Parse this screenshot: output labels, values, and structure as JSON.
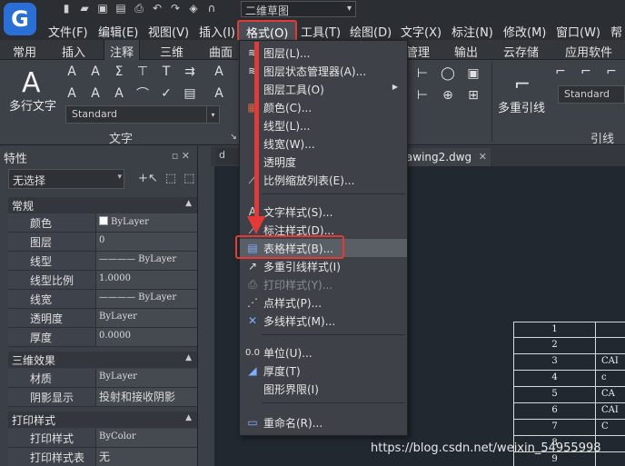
{
  "workspace": "二维草图",
  "menubar": [
    "文件(F)",
    "编辑(E)",
    "视图(V)",
    "插入(I)",
    "格式(O)",
    "工具(T)",
    "绘图(D)",
    "文字(X)",
    "标注(N)",
    "修改(M)",
    "窗口(W)",
    "帮"
  ],
  "ribbon_tabs": [
    "常用",
    "插入",
    "注释",
    "三维",
    "曲面",
    "管理",
    "输出",
    "云存储",
    "应用软件"
  ],
  "ribbon": {
    "mtext_label": "多行文字",
    "text_style": "Standard",
    "text_panel": "文字",
    "mleader_label": "多重引线",
    "mleader_style": "Standard",
    "leader_panel": "引线"
  },
  "props": {
    "title": "特性",
    "selection": "无选择",
    "sections": {
      "general": "常规",
      "3d": "三维效果",
      "plot": "打印样式"
    },
    "rows": [
      {
        "k": "颜色",
        "v": "ByLayer"
      },
      {
        "k": "图层",
        "v": "0"
      },
      {
        "k": "线型",
        "v": "———— ByLayer"
      },
      {
        "k": "线型比例",
        "v": "1.0000"
      },
      {
        "k": "线宽",
        "v": "———— ByLayer"
      },
      {
        "k": "透明度",
        "v": "ByLayer"
      },
      {
        "k": "厚度",
        "v": "0.0000"
      }
    ],
    "rows3d": [
      {
        "k": "材质",
        "v": "ByLayer"
      },
      {
        "k": "阴影显示",
        "v": "投射和接收阴影"
      }
    ],
    "rowsplot": [
      {
        "k": "打印样式",
        "v": "ByColor"
      },
      {
        "k": "打印样式表",
        "v": "无"
      }
    ]
  },
  "doc_tabs": {
    "t1": "d",
    "t2": "rawing2.dwg"
  },
  "dropdown": [
    {
      "icon": "layer-icon",
      "label": "图层(L)...",
      "glyph": "≋"
    },
    {
      "icon": "layer-state-icon",
      "label": "图层状态管理器(A)...",
      "glyph": "≋"
    },
    {
      "icon": "",
      "label": "图层工具(O)",
      "glyph": "",
      "sub": true
    },
    {
      "icon": "color-icon",
      "label": "颜色(C)...",
      "glyph": "▦"
    },
    {
      "icon": "",
      "label": "线型(L)...",
      "glyph": ""
    },
    {
      "icon": "",
      "label": "线宽(W)...",
      "glyph": ""
    },
    {
      "icon": "",
      "label": "透明度",
      "glyph": ""
    },
    {
      "icon": "scale-list-icon",
      "label": "比例缩放列表(E)...",
      "glyph": "⟋"
    },
    {
      "icon": "text-style-icon",
      "label": "文字样式(S)...",
      "glyph": "A"
    },
    {
      "icon": "dim-style-icon",
      "label": "标注样式(D)...",
      "glyph": "⟋"
    },
    {
      "icon": "table-style-icon",
      "label": "表格样式(B)...",
      "glyph": "▤"
    },
    {
      "icon": "mleader-style-icon",
      "label": "多重引线样式(I)",
      "glyph": "↗"
    },
    {
      "icon": "plot-style-icon",
      "label": "打印样式(Y)...",
      "glyph": "⎙",
      "disabled": true
    },
    {
      "icon": "point-style-icon",
      "label": "点样式(P)...",
      "glyph": "⋰"
    },
    {
      "icon": "mline-style-icon",
      "label": "多线样式(M)...",
      "glyph": "✕"
    },
    {
      "icon": "units-icon",
      "label": "单位(U)...",
      "glyph": "0.0"
    },
    {
      "icon": "thickness-icon",
      "label": "厚度(T)",
      "glyph": "◢"
    },
    {
      "icon": "",
      "label": "图形界限(I)",
      "glyph": ""
    },
    {
      "icon": "rename-icon",
      "label": "重命名(R)...",
      "glyph": "▭"
    }
  ],
  "table_rows": [
    {
      "n": "1",
      "c": ""
    },
    {
      "n": "2",
      "c": ""
    },
    {
      "n": "3",
      "c": "CAI"
    },
    {
      "n": "4",
      "c": "c"
    },
    {
      "n": "5",
      "c": "CA"
    },
    {
      "n": "6",
      "c": "CAI"
    },
    {
      "n": "7",
      "c": "C"
    },
    {
      "n": "8",
      "c": ""
    },
    {
      "n": "9",
      "c": ""
    }
  ],
  "watermark": "https://blog.csdn.net/weixin_54955998"
}
